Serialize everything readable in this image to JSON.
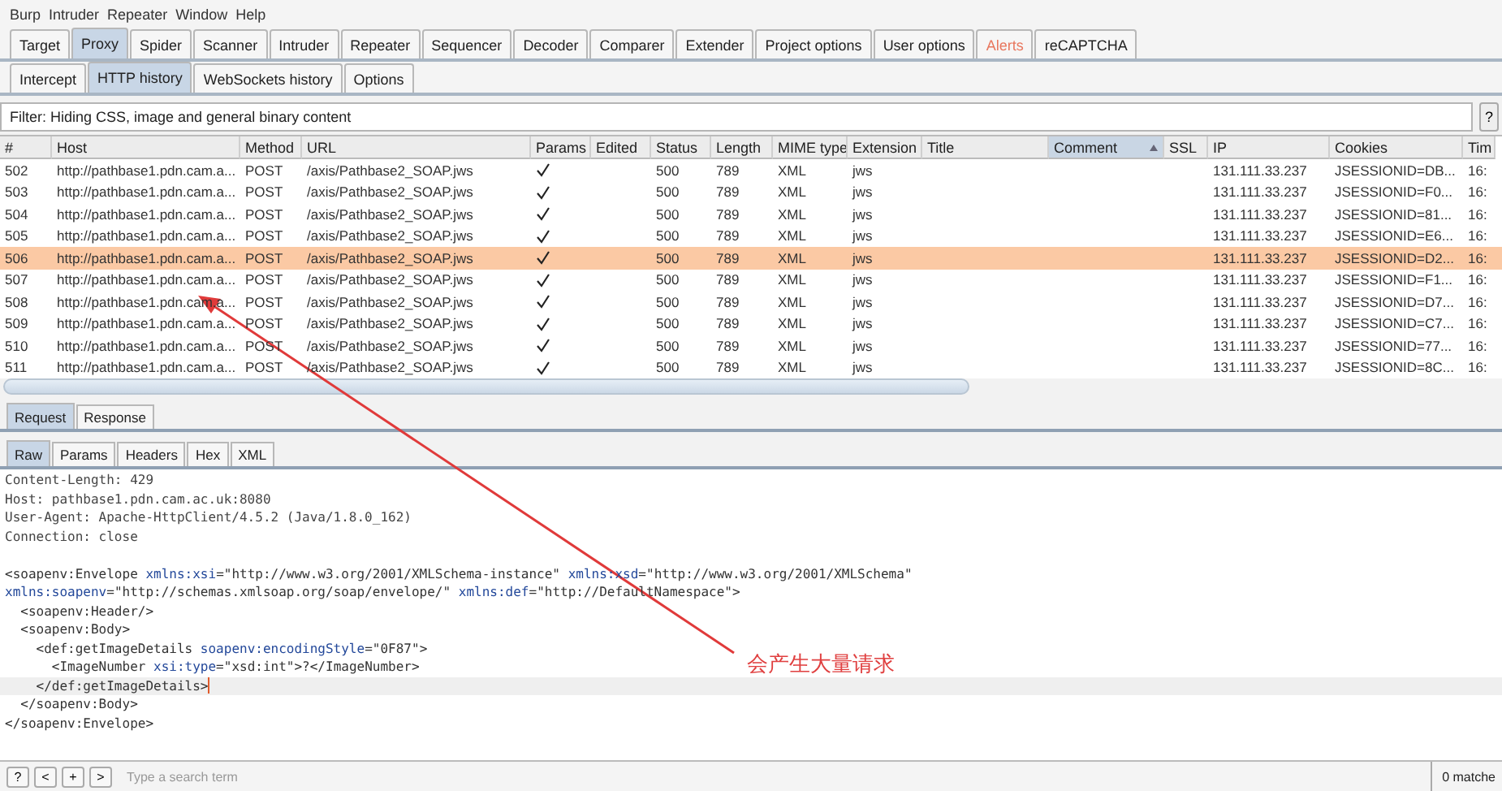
{
  "menu": [
    "Burp",
    "Intruder",
    "Repeater",
    "Window",
    "Help"
  ],
  "tabs": [
    {
      "label": "Target",
      "selected": false,
      "alert": false
    },
    {
      "label": "Proxy",
      "selected": true,
      "alert": false
    },
    {
      "label": "Spider",
      "selected": false,
      "alert": false
    },
    {
      "label": "Scanner",
      "selected": false,
      "alert": false
    },
    {
      "label": "Intruder",
      "selected": false,
      "alert": false
    },
    {
      "label": "Repeater",
      "selected": false,
      "alert": false
    },
    {
      "label": "Sequencer",
      "selected": false,
      "alert": false
    },
    {
      "label": "Decoder",
      "selected": false,
      "alert": false
    },
    {
      "label": "Comparer",
      "selected": false,
      "alert": false
    },
    {
      "label": "Extender",
      "selected": false,
      "alert": false
    },
    {
      "label": "Project options",
      "selected": false,
      "alert": false
    },
    {
      "label": "User options",
      "selected": false,
      "alert": false
    },
    {
      "label": "Alerts",
      "selected": false,
      "alert": true
    },
    {
      "label": "reCAPTCHA",
      "selected": false,
      "alert": false
    }
  ],
  "subtabs": [
    {
      "label": "Intercept",
      "selected": false
    },
    {
      "label": "HTTP history",
      "selected": true
    },
    {
      "label": "WebSockets history",
      "selected": false
    },
    {
      "label": "Options",
      "selected": false
    }
  ],
  "filter": "Filter: Hiding CSS, image and general binary content",
  "filter_help": "?",
  "table": {
    "columns": [
      {
        "label": "#",
        "sorted": false
      },
      {
        "label": "Host",
        "sorted": false
      },
      {
        "label": "Method",
        "sorted": false
      },
      {
        "label": "URL",
        "sorted": false
      },
      {
        "label": "Params",
        "sorted": false
      },
      {
        "label": "Edited",
        "sorted": false
      },
      {
        "label": "Status",
        "sorted": false
      },
      {
        "label": "Length",
        "sorted": false
      },
      {
        "label": "MIME type",
        "sorted": false
      },
      {
        "label": "Extension",
        "sorted": false
      },
      {
        "label": "Title",
        "sorted": false
      },
      {
        "label": "Comment",
        "sorted": true
      },
      {
        "label": "SSL",
        "sorted": false
      },
      {
        "label": "IP",
        "sorted": false
      },
      {
        "label": "Cookies",
        "sorted": false
      },
      {
        "label": "Tim",
        "sorted": false
      }
    ],
    "rows": [
      {
        "num": "502",
        "host": "http://pathbase1.pdn.cam.a...",
        "method": "POST",
        "url": "/axis/Pathbase2_SOAP.jws",
        "params": true,
        "status": "500",
        "length": "789",
        "mime": "XML",
        "ext": "jws",
        "ip": "131.111.33.237",
        "cookies": "JSESSIONID=DB...",
        "time": "16:",
        "selected": false
      },
      {
        "num": "503",
        "host": "http://pathbase1.pdn.cam.a...",
        "method": "POST",
        "url": "/axis/Pathbase2_SOAP.jws",
        "params": true,
        "status": "500",
        "length": "789",
        "mime": "XML",
        "ext": "jws",
        "ip": "131.111.33.237",
        "cookies": "JSESSIONID=F0...",
        "time": "16:",
        "selected": false
      },
      {
        "num": "504",
        "host": "http://pathbase1.pdn.cam.a...",
        "method": "POST",
        "url": "/axis/Pathbase2_SOAP.jws",
        "params": true,
        "status": "500",
        "length": "789",
        "mime": "XML",
        "ext": "jws",
        "ip": "131.111.33.237",
        "cookies": "JSESSIONID=81...",
        "time": "16:",
        "selected": false
      },
      {
        "num": "505",
        "host": "http://pathbase1.pdn.cam.a...",
        "method": "POST",
        "url": "/axis/Pathbase2_SOAP.jws",
        "params": true,
        "status": "500",
        "length": "789",
        "mime": "XML",
        "ext": "jws",
        "ip": "131.111.33.237",
        "cookies": "JSESSIONID=E6...",
        "time": "16:",
        "selected": false
      },
      {
        "num": "506",
        "host": "http://pathbase1.pdn.cam.a...",
        "method": "POST",
        "url": "/axis/Pathbase2_SOAP.jws",
        "params": true,
        "status": "500",
        "length": "789",
        "mime": "XML",
        "ext": "jws",
        "ip": "131.111.33.237",
        "cookies": "JSESSIONID=D2...",
        "time": "16:",
        "selected": true
      },
      {
        "num": "507",
        "host": "http://pathbase1.pdn.cam.a...",
        "method": "POST",
        "url": "/axis/Pathbase2_SOAP.jws",
        "params": true,
        "status": "500",
        "length": "789",
        "mime": "XML",
        "ext": "jws",
        "ip": "131.111.33.237",
        "cookies": "JSESSIONID=F1...",
        "time": "16:",
        "selected": false
      },
      {
        "num": "508",
        "host": "http://pathbase1.pdn.cam.a...",
        "method": "POST",
        "url": "/axis/Pathbase2_SOAP.jws",
        "params": true,
        "status": "500",
        "length": "789",
        "mime": "XML",
        "ext": "jws",
        "ip": "131.111.33.237",
        "cookies": "JSESSIONID=D7...",
        "time": "16:",
        "selected": false
      },
      {
        "num": "509",
        "host": "http://pathbase1.pdn.cam.a...",
        "method": "POST",
        "url": "/axis/Pathbase2_SOAP.jws",
        "params": true,
        "status": "500",
        "length": "789",
        "mime": "XML",
        "ext": "jws",
        "ip": "131.111.33.237",
        "cookies": "JSESSIONID=C7...",
        "time": "16:",
        "selected": false
      },
      {
        "num": "510",
        "host": "http://pathbase1.pdn.cam.a...",
        "method": "POST",
        "url": "/axis/Pathbase2_SOAP.jws",
        "params": true,
        "status": "500",
        "length": "789",
        "mime": "XML",
        "ext": "jws",
        "ip": "131.111.33.237",
        "cookies": "JSESSIONID=77...",
        "time": "16:",
        "selected": false
      },
      {
        "num": "511",
        "host": "http://pathbase1.pdn.cam.a...",
        "method": "POST",
        "url": "/axis/Pathbase2_SOAP.jws",
        "params": true,
        "status": "500",
        "length": "789",
        "mime": "XML",
        "ext": "jws",
        "ip": "131.111.33.237",
        "cookies": "JSESSIONID=8C...",
        "time": "16:",
        "selected": false
      }
    ]
  },
  "message_tabs": [
    {
      "label": "Request",
      "selected": true
    },
    {
      "label": "Response",
      "selected": false
    }
  ],
  "view_tabs": [
    {
      "label": "Raw",
      "selected": true
    },
    {
      "label": "Params",
      "selected": false
    },
    {
      "label": "Headers",
      "selected": false
    },
    {
      "label": "Hex",
      "selected": false
    },
    {
      "label": "XML",
      "selected": false
    }
  ],
  "editor_lines": [
    {
      "current": false,
      "tokens": [
        {
          "kind": "plain",
          "text": "Content-Length: 429"
        }
      ]
    },
    {
      "current": false,
      "tokens": [
        {
          "kind": "plain",
          "text": "Host: pathbase1.pdn.cam.ac.uk:8080"
        }
      ]
    },
    {
      "current": false,
      "tokens": [
        {
          "kind": "plain",
          "text": "User-Agent: Apache-HttpClient/4.5.2 (Java/1.8.0_162)"
        }
      ]
    },
    {
      "current": false,
      "tokens": [
        {
          "kind": "plain",
          "text": "Connection: close"
        }
      ]
    },
    {
      "current": false
    },
    {
      "current": false,
      "tokens": [
        {
          "kind": "tag",
          "text": "<soapenv:Envelope "
        },
        {
          "kind": "attr",
          "text": "xmlns:xsi"
        },
        {
          "kind": "tag",
          "text": "="
        },
        {
          "kind": "value",
          "text": "\"http://www.w3.org/2001/XMLSchema-instance\""
        },
        {
          "kind": "attr",
          "text": " xmlns:xsd"
        },
        {
          "kind": "tag",
          "text": "="
        },
        {
          "kind": "value",
          "text": "\"http://www.w3.org/2001/XMLSchema\""
        }
      ]
    },
    {
      "current": false,
      "tokens": [
        {
          "kind": "attr",
          "text": "xmlns:soapenv"
        },
        {
          "kind": "tag",
          "text": "="
        },
        {
          "kind": "value",
          "text": "\"http://schemas.xmlsoap.org/soap/envelope/\""
        },
        {
          "kind": "attr",
          "text": " xmlns:def"
        },
        {
          "kind": "tag",
          "text": "="
        },
        {
          "kind": "value",
          "text": "\"http://DefaultNamespace\""
        },
        {
          "kind": "tag",
          "text": ">"
        }
      ]
    },
    {
      "current": false,
      "tokens": [
        {
          "kind": "tag",
          "text": "  <soapenv:Header/>"
        }
      ]
    },
    {
      "current": false,
      "tokens": [
        {
          "kind": "tag",
          "text": "  <soapenv:Body>"
        }
      ]
    },
    {
      "current": false,
      "tokens": [
        {
          "kind": "tag",
          "text": "    <def:getImageDetails "
        },
        {
          "kind": "attr",
          "text": "soapenv:encodingStyle"
        },
        {
          "kind": "tag",
          "text": "="
        },
        {
          "kind": "value",
          "text": "\"0F87\""
        },
        {
          "kind": "tag",
          "text": ">"
        }
      ]
    },
    {
      "current": false,
      "tokens": [
        {
          "kind": "tag",
          "text": "      <ImageNumber "
        },
        {
          "kind": "attr",
          "text": "xsi:type"
        },
        {
          "kind": "tag",
          "text": "="
        },
        {
          "kind": "value",
          "text": "\"xsd:int\""
        },
        {
          "kind": "tag",
          "text": ">?</ImageNumber>"
        }
      ]
    },
    {
      "current": true,
      "tokens": [
        {
          "kind": "tag",
          "text": "    </def:getImageDetails>"
        }
      ]
    },
    {
      "current": false,
      "tokens": [
        {
          "kind": "tag",
          "text": "  </soapenv:Body>"
        }
      ]
    },
    {
      "current": false,
      "tokens": [
        {
          "kind": "tag",
          "text": "</soapenv:Envelope>"
        }
      ]
    }
  ],
  "annotation": "会产生大量请求",
  "search_bar": {
    "buttons": [
      "?",
      "<",
      "+",
      ">"
    ],
    "placeholder": "Type a search term",
    "matches": "0 matche"
  }
}
